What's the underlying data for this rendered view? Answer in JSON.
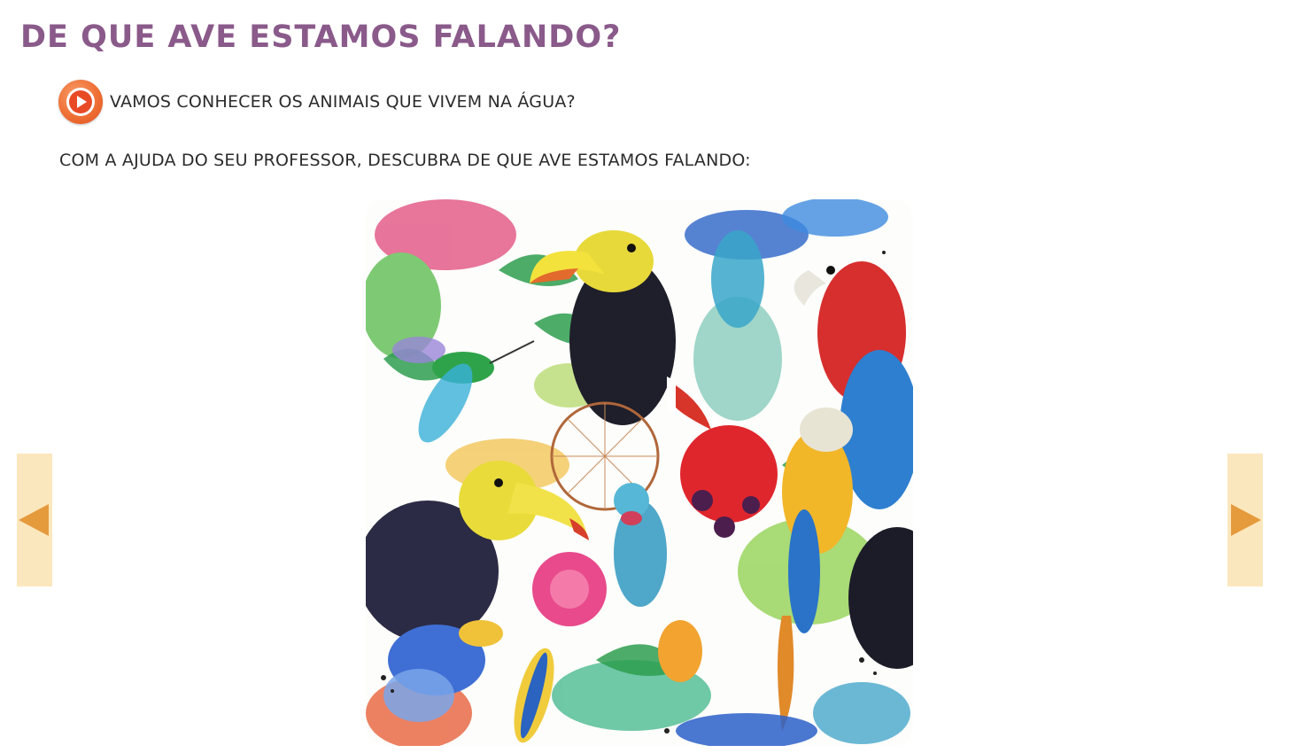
{
  "header": {
    "title": "DE QUE AVE ESTAMOS FALANDO?"
  },
  "audio": {
    "icon": "play-icon",
    "label": "VAMOS CONHECER OS ANIMAIS QUE VIVEM NA ÁGUA?",
    "color": "#ef6f35"
  },
  "instruction": {
    "text": "COM A AJUDA DO SEU PROFESSOR, DESCUBRA DE QUE AVE ESTAMOS FALANDO:"
  },
  "gallery": {
    "image_subject": "watercolor tropical birds illustration",
    "prev_icon": "arrow-left-icon",
    "next_icon": "arrow-right-icon",
    "nav_background": "#fbe7bd",
    "nav_arrow_color": "#e59a3c"
  },
  "colors": {
    "title": "#8a5a8a",
    "text": "#2b2b2b"
  }
}
